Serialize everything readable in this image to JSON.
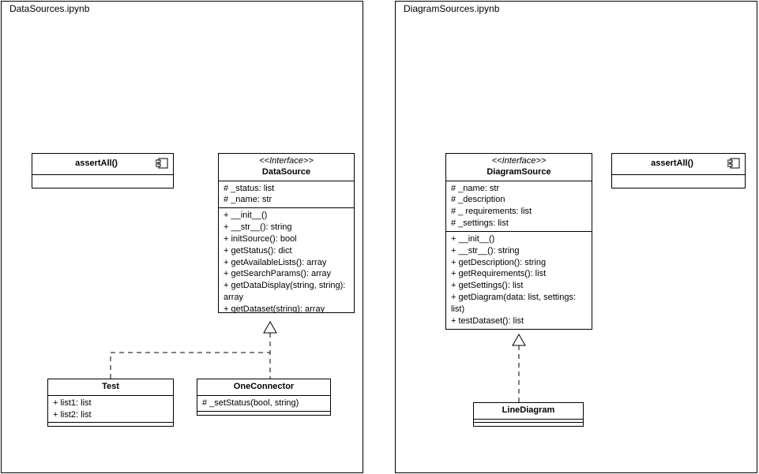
{
  "packages": {
    "left": {
      "label": "DataSources.ipynb"
    },
    "right": {
      "label": "DiagramSources.ipynb"
    }
  },
  "classes": {
    "assertLeft": {
      "name": "assertAll()"
    },
    "assertRight": {
      "name": "assertAll()"
    },
    "dataSource": {
      "stereo": "<<Interface>>",
      "name": "DataSource",
      "attrs": [
        "# _status: list",
        "# _name: str"
      ],
      "ops": [
        "+ __init__()",
        "+ __str__(): string",
        "+ initSource(): bool",
        "+ getStatus(): dict",
        "+ getAvailableLists(): array",
        "+ getSearchParams(): array",
        "+ getDataDisplay(string, string): array",
        "+ getDataset(string): array"
      ]
    },
    "test": {
      "name": "Test",
      "attrs": [
        "+ list1: list",
        "+ list2: list"
      ]
    },
    "oneConnector": {
      "name": "OneConnector",
      "attrs": [
        "# _setStatus(bool, string)"
      ]
    },
    "diagramSource": {
      "stereo": "<<Interface>>",
      "name": "DiagramSource",
      "attrs": [
        "# _name: str",
        "# _description",
        "# _ requirements: list",
        "# _settings: list"
      ],
      "ops": [
        "+ __init__()",
        "+ __str__(): string",
        "+ getDescription(): string",
        "+ getRequirements(): list",
        "+ getSettings(): list",
        "+ getDiagram(data: list, settings: list)",
        "+ testDataset(): list"
      ]
    },
    "lineDiagram": {
      "name": "LineDiagram"
    }
  }
}
